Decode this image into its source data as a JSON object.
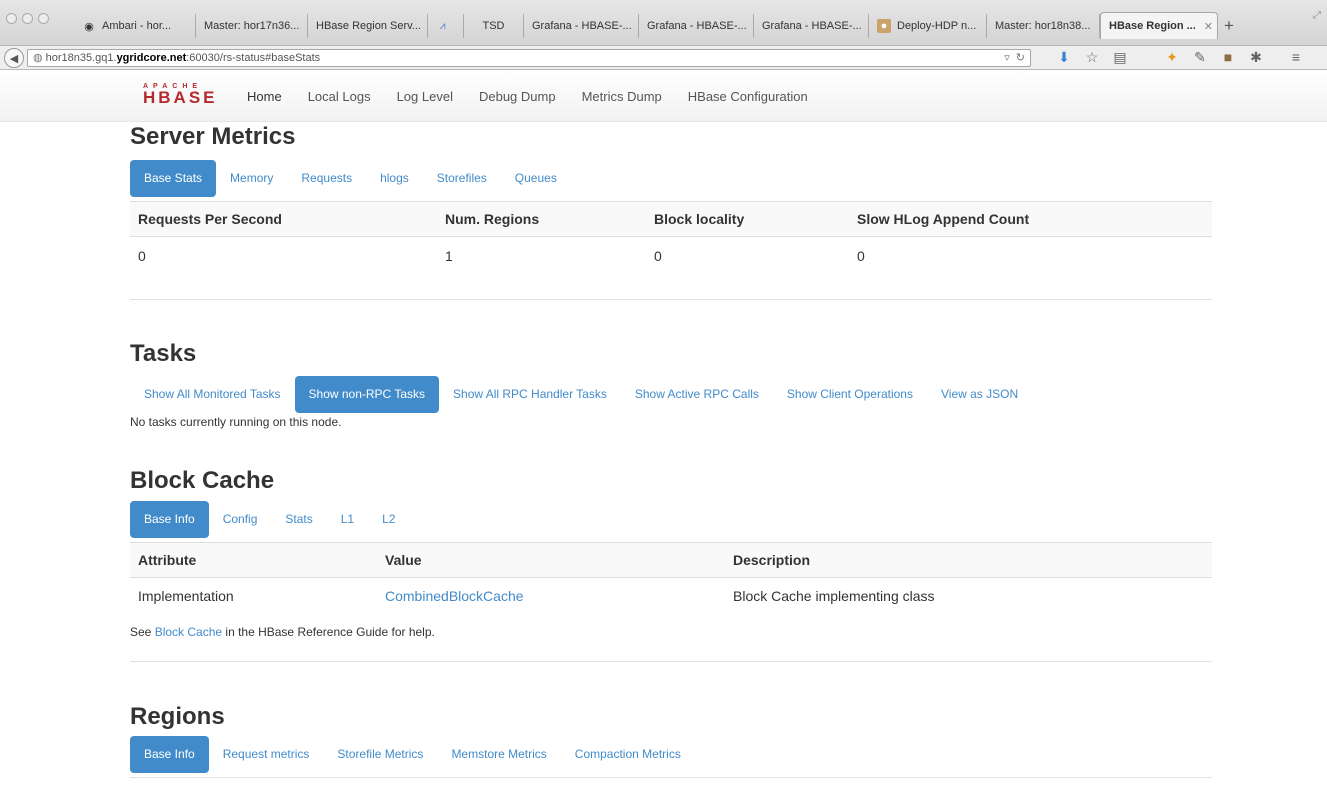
{
  "browser": {
    "tabs": [
      {
        "label": "Ambari - hor...",
        "icon": "ambari-icon"
      },
      {
        "label": "Master: hor17n36...",
        "icon": ""
      },
      {
        "label": "HBase Region Serv...",
        "icon": ""
      },
      {
        "label": "",
        "icon": "chart-icon"
      },
      {
        "label": "TSD",
        "icon": ""
      },
      {
        "label": "Grafana - HBASE-...",
        "icon": ""
      },
      {
        "label": "Grafana - HBASE-...",
        "icon": ""
      },
      {
        "label": "Grafana - HBASE-...",
        "icon": ""
      },
      {
        "label": "Deploy-HDP n...",
        "icon": "avatar-icon"
      },
      {
        "label": "Master: hor18n38...",
        "icon": ""
      },
      {
        "label": "HBase Region ...",
        "icon": "",
        "active": true
      }
    ],
    "url": {
      "pre": "hor18n35.gq1.",
      "host": "ygridcore.net",
      "post": ":60030/rs-status#baseStats"
    }
  },
  "logo": {
    "apache": "APACHE",
    "name": "HBASE"
  },
  "nav": [
    "Home",
    "Local Logs",
    "Log Level",
    "Debug Dump",
    "Metrics Dump",
    "HBase Configuration"
  ],
  "server_metrics": {
    "title": "Server Metrics",
    "tabs": [
      "Base Stats",
      "Memory",
      "Requests",
      "hlogs",
      "Storefiles",
      "Queues"
    ],
    "headers": [
      "Requests Per Second",
      "Num. Regions",
      "Block locality",
      "Slow HLog Append Count"
    ],
    "row": [
      "0",
      "1",
      "0",
      "0"
    ]
  },
  "tasks": {
    "title": "Tasks",
    "tabs": [
      "Show All Monitored Tasks",
      "Show non-RPC Tasks",
      "Show All RPC Handler Tasks",
      "Show Active RPC Calls",
      "Show Client Operations",
      "View as JSON"
    ],
    "message": "No tasks currently running on this node."
  },
  "block_cache": {
    "title": "Block Cache",
    "tabs": [
      "Base Info",
      "Config",
      "Stats",
      "L1",
      "L2"
    ],
    "headers": [
      "Attribute",
      "Value",
      "Description"
    ],
    "row": [
      "Implementation",
      "CombinedBlockCache",
      "Block Cache implementing class"
    ],
    "note_pre": "See ",
    "note_link": "Block Cache",
    "note_post": " in the HBase Reference Guide for help."
  },
  "regions": {
    "title": "Regions",
    "tabs": [
      "Base Info",
      "Request metrics",
      "Storefile Metrics",
      "Memstore Metrics",
      "Compaction Metrics"
    ]
  },
  "colors": {
    "accent": "#428bca",
    "logo": "#b4282e"
  }
}
